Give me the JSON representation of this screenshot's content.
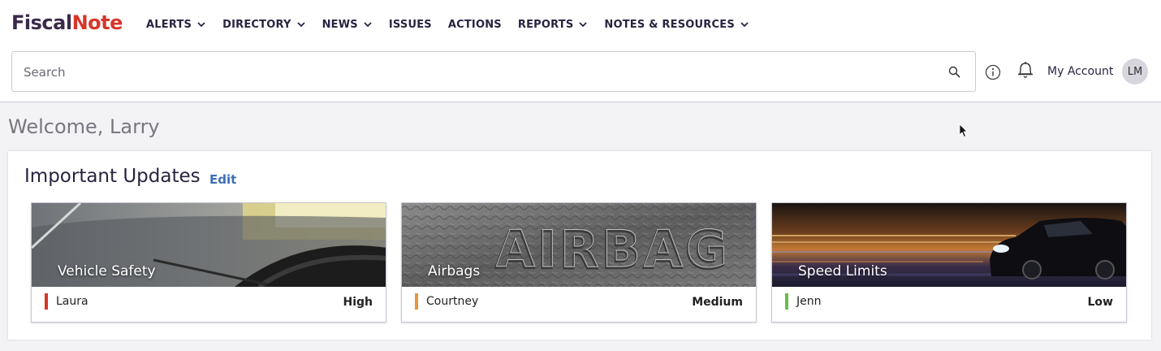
{
  "brand": {
    "part1": "Fiscal",
    "part2": "Note"
  },
  "nav": [
    {
      "label": "ALERTS",
      "dropdown": true
    },
    {
      "label": "DIRECTORY",
      "dropdown": true
    },
    {
      "label": "NEWS",
      "dropdown": true
    },
    {
      "label": "ISSUES",
      "dropdown": false
    },
    {
      "label": "ACTIONS",
      "dropdown": false
    },
    {
      "label": "REPORTS",
      "dropdown": true
    },
    {
      "label": "NOTES & RESOURCES",
      "dropdown": true
    }
  ],
  "search": {
    "placeholder": "Search"
  },
  "account": {
    "label": "My Account",
    "initials": "LM"
  },
  "welcome": "Welcome, Larry",
  "updates": {
    "title": "Important Updates",
    "edit_label": "Edit",
    "cards": [
      {
        "title": "Vehicle Safety",
        "owner": "Laura",
        "priority": "High",
        "color": "#d6362a"
      },
      {
        "title": "Airbags",
        "owner": "Courtney",
        "priority": "Medium",
        "color": "#e8963a"
      },
      {
        "title": "Speed Limits",
        "owner": "Jenn",
        "priority": "Low",
        "color": "#6abf45"
      }
    ]
  },
  "colors": {
    "brand_dark": "#3a2a4a",
    "brand_red": "#d6362a",
    "link": "#3c6fb4"
  }
}
